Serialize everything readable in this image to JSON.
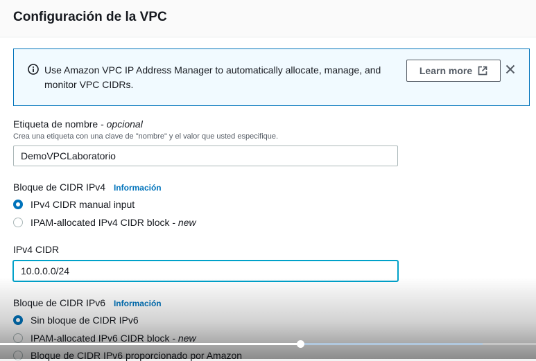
{
  "header": {
    "title": "Configuración de la VPC"
  },
  "alert": {
    "icon": "info-icon",
    "message": "Use Amazon VPC IP Address Manager to automatically allocate, manage, and monitor VPC CIDRs.",
    "learn_more_label": "Learn more",
    "learn_more_icon": "external-link-icon",
    "close_icon": "close-icon"
  },
  "name_tag": {
    "label": "Etiqueta de nombre",
    "optional": "opcional",
    "description": "Crea una etiqueta con una clave de \"nombre\" y el valor que usted especifique.",
    "value": "DemoVPCLaboratorio"
  },
  "ipv4_block": {
    "label": "Bloque de CIDR IPv4",
    "info_label": "Información",
    "options": [
      {
        "label": "IPv4 CIDR manual input",
        "selected": true
      },
      {
        "label": "IPAM-allocated IPv4 CIDR block - ",
        "tag": "new",
        "selected": false
      }
    ]
  },
  "ipv4_cidr": {
    "label": "IPv4 CIDR",
    "value": "10.0.0.0/24"
  },
  "ipv6_block": {
    "label": "Bloque de CIDR IPv6",
    "info_label": "Información",
    "options": [
      {
        "label": "Sin bloque de CIDR IPv6",
        "selected": true
      },
      {
        "label": "IPAM-allocated IPv6 CIDR block - ",
        "tag": "new",
        "selected": false
      },
      {
        "label": "Bloque de CIDR IPv6 proporcionado por Amazon",
        "selected": false
      }
    ]
  },
  "video_player": {
    "played_fraction": 0.56,
    "buffered_fraction": 0.9
  },
  "colors": {
    "accent": "#0073bb",
    "alert_bg": "#f1faff",
    "focus": "#00a1c9"
  }
}
